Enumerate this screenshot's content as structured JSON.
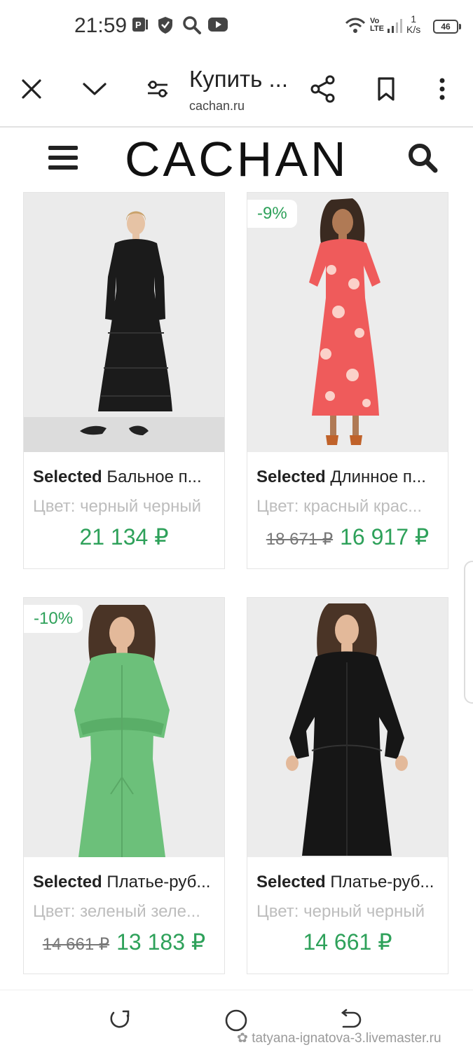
{
  "status_bar": {
    "time": "21:59",
    "network_type": "LTE",
    "speed_value": "1",
    "speed_unit": "K/s",
    "battery": "46"
  },
  "browser": {
    "page_title": "Купить ...",
    "url": "cachan.ru"
  },
  "site": {
    "logo": "CACHAN"
  },
  "products": [
    {
      "brand": "Selected",
      "name": "Бальное п...",
      "color": "Цвет: черный черный",
      "old_price": "",
      "price": "21 134 ₽",
      "discount": "",
      "image": "black-tiered-dress"
    },
    {
      "brand": "Selected",
      "name": "Длинное п...",
      "color": "Цвет: красный крас...",
      "old_price": "18 671 ₽",
      "price": "16 917 ₽",
      "discount": "-9%",
      "image": "red-floral-dress"
    },
    {
      "brand": "Selected",
      "name": "Платье-руб...",
      "color": "Цвет: зеленый зеле...",
      "old_price": "14 661 ₽",
      "price": "13 183 ₽",
      "discount": "-10%",
      "image": "green-shirt-dress"
    },
    {
      "brand": "Selected",
      "name": "Платье-руб...",
      "color": "Цвет: черный черный",
      "old_price": "",
      "price": "14 661 ₽",
      "discount": "",
      "image": "black-shirt-dress"
    }
  ],
  "watermark": "tatyana-ignatova-3.livemaster.ru",
  "colors": {
    "accent": "#2ea15a",
    "muted_text": "#bdbdbd"
  }
}
